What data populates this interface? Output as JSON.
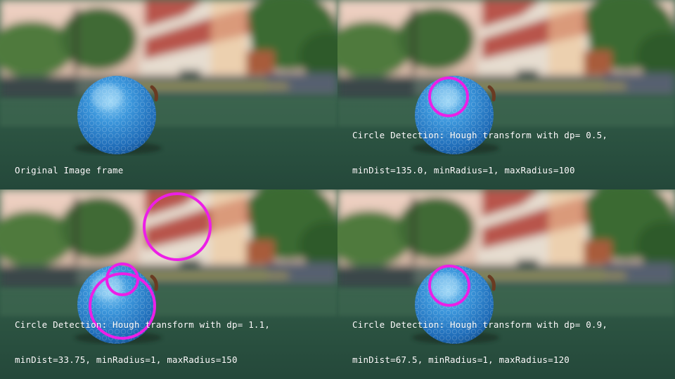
{
  "layout": "2x2 grid of video frames",
  "colors": {
    "circle": "#ec1fe6",
    "caption_text": "#ffffff",
    "ball": "#2b86cf",
    "grass": "#2f5a45",
    "sky": "#e9c3b3",
    "tower_red": "#b8554c",
    "tower_white": "#e6ddd0"
  },
  "scene": {
    "subject": "blue golf ball on artificial grass",
    "background": "red and white striped lighthouse, trees, pink sky (blurred)"
  },
  "panels": [
    {
      "name": "original",
      "caption_lines": [
        "",
        "Original Image frame"
      ],
      "detected_circle_count": 0
    },
    {
      "name": "dp-0.5",
      "caption_lines": [
        "Circle Detection: Hough transform with dp= 0.5,",
        "minDist=135.0, minRadius=1, maxRadius=100"
      ],
      "detected_circle_count": 1
    },
    {
      "name": "dp-1.1",
      "caption_lines": [
        "Circle Detection: Hough transform with dp= 1.1,",
        "minDist=33.75, minRadius=1, maxRadius=150"
      ],
      "detected_circle_count": 3
    },
    {
      "name": "dp-0.9",
      "caption_lines": [
        "Circle Detection: Hough transform with dp= 0.9,",
        "minDist=67.5, minRadius=1, maxRadius=120"
      ],
      "detected_circle_count": 1
    }
  ]
}
